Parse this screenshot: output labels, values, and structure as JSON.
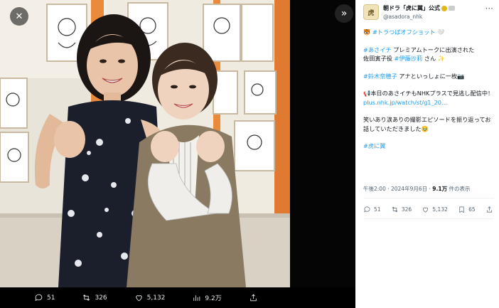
{
  "viewer": {
    "close_icon_glyph": "✕",
    "expand_icon_glyph": "»",
    "actions": [
      {
        "name": "reply",
        "count": "51"
      },
      {
        "name": "repost",
        "count": "326"
      },
      {
        "name": "like",
        "count": "5,132"
      },
      {
        "name": "views",
        "count": "9.2万"
      },
      {
        "name": "share",
        "count": ""
      }
    ]
  },
  "tweet": {
    "display_name": "朝ドラ「虎に翼」公式",
    "handle": "@asadora_nhk",
    "avatar_text": "虎",
    "more_glyph": "···",
    "body": {
      "line1_tag": "#トラつばオフショット",
      "line1_emoji": "🤍",
      "p2_tag": "#あさイチ",
      "p2_text": " プレミアムトークに出演された",
      "p2_text2": "佐田寅子役 ",
      "p2_tag2": "#伊藤沙莉",
      "p2_text3": " さん ✨",
      "p3_tag": "#鈴木奈穂子",
      "p3_text": " アナといっしょに一枚📷",
      "p4_text": "📢本日のあさイチもNHKプラスで見逃し配信中！ ",
      "p4_link": "plus.nhk.jp/watch/st/g1_20...",
      "p5_text": "笑いあり涙ありの撮影エピソードを振り返ってお話していただきました🥹",
      "p6_tag": "#虎に翼"
    },
    "meta": {
      "time": "午後2:00 · 2024年9月6日 · ",
      "views": "9.1万",
      "views_label": " 件の表示"
    },
    "stats": {
      "replies": "51",
      "reposts": "326",
      "likes": "5,132",
      "bookmarks": "65"
    }
  },
  "colors": {
    "link": "#1d9bf0",
    "text": "#0f1419",
    "muted": "#536471"
  }
}
